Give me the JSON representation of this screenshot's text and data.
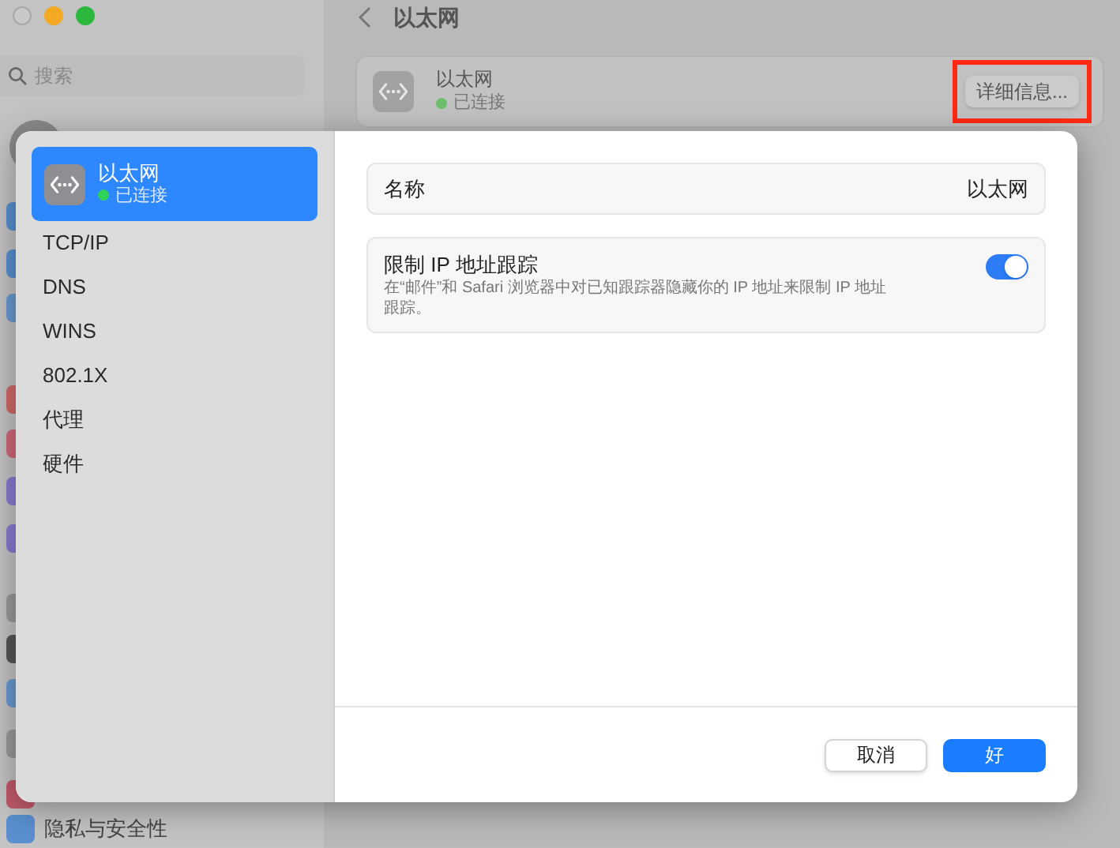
{
  "sidebar": {
    "search": {
      "placeholder": "搜索"
    },
    "items": [
      {
        "label": "隐私与安全性"
      }
    ]
  },
  "header": {
    "title": "以太网"
  },
  "service_card": {
    "name": "以太网",
    "status": "已连接",
    "connected": true,
    "details_button": "详细信息...",
    "highlighted": true
  },
  "sheet": {
    "sidebar": {
      "items": [
        {
          "kind": "service",
          "label": "以太网",
          "status": "已连接",
          "connected": true,
          "selected": true
        },
        {
          "kind": "tab",
          "label": "TCP/IP",
          "selected": false
        },
        {
          "kind": "tab",
          "label": "DNS",
          "selected": false
        },
        {
          "kind": "tab",
          "label": "WINS",
          "selected": false
        },
        {
          "kind": "tab",
          "label": "802.1X",
          "selected": false
        },
        {
          "kind": "tab",
          "label": "代理",
          "selected": false
        },
        {
          "kind": "tab",
          "label": "硬件",
          "selected": false
        }
      ]
    },
    "name_row": {
      "label": "名称",
      "value": "以太网"
    },
    "tracking": {
      "label": "限制 IP 地址跟踪",
      "description": "在“邮件”和 Safari 浏览器中对已知跟踪器隐藏你的 IP 地址来限制 IP 地址跟踪。",
      "on": true
    },
    "buttons": [
      {
        "label": "取消",
        "kind": "secondary"
      },
      {
        "label": "好",
        "kind": "primary"
      }
    ]
  }
}
